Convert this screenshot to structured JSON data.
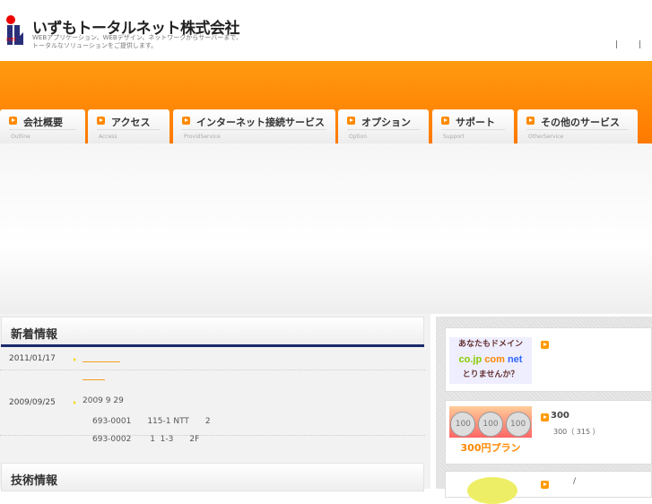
{
  "header": {
    "company": "いずもトータルネット株式会社",
    "tagline1": "WEBアプリケーション、WEBデザイン、ネットワークからサーバーまで、",
    "tagline2": "トータルなソリューションをご提供します。",
    "links": "| |",
    "logo_text": "net"
  },
  "nav": [
    {
      "label": "会社概要",
      "sub": "Outline"
    },
    {
      "label": "アクセス",
      "sub": "Access"
    },
    {
      "label": "インターネット接続サービス",
      "sub": "ProvidService"
    },
    {
      "label": "オプション",
      "sub": "Option"
    },
    {
      "label": "サポート",
      "sub": "Support"
    },
    {
      "label": "その他のサービス",
      "sub": "OtherService"
    }
  ],
  "news": {
    "title": "新着情報",
    "items": [
      {
        "date": "2011/01/17"
      },
      {
        "date": "2009/09/25",
        "text": "2009 9 29",
        "line1": "693-0001　　115-1 NTT　　2",
        "line2": "693-0002　　 1  1-3　　2F"
      }
    ]
  },
  "tech": {
    "title": "技術情報"
  },
  "sidebar": {
    "domain_banner": {
      "line1": "あなたもドメイン",
      "co": "co.jp",
      "com": "com",
      "net": "net",
      "line3": "とりませんか？"
    },
    "plan_banner": {
      "coins": [
        "100",
        "100",
        "100"
      ],
      "label": "300円プラン"
    },
    "plan_title": "300",
    "plan_desc": "300（ 315 ）",
    "third_title": "/"
  }
}
